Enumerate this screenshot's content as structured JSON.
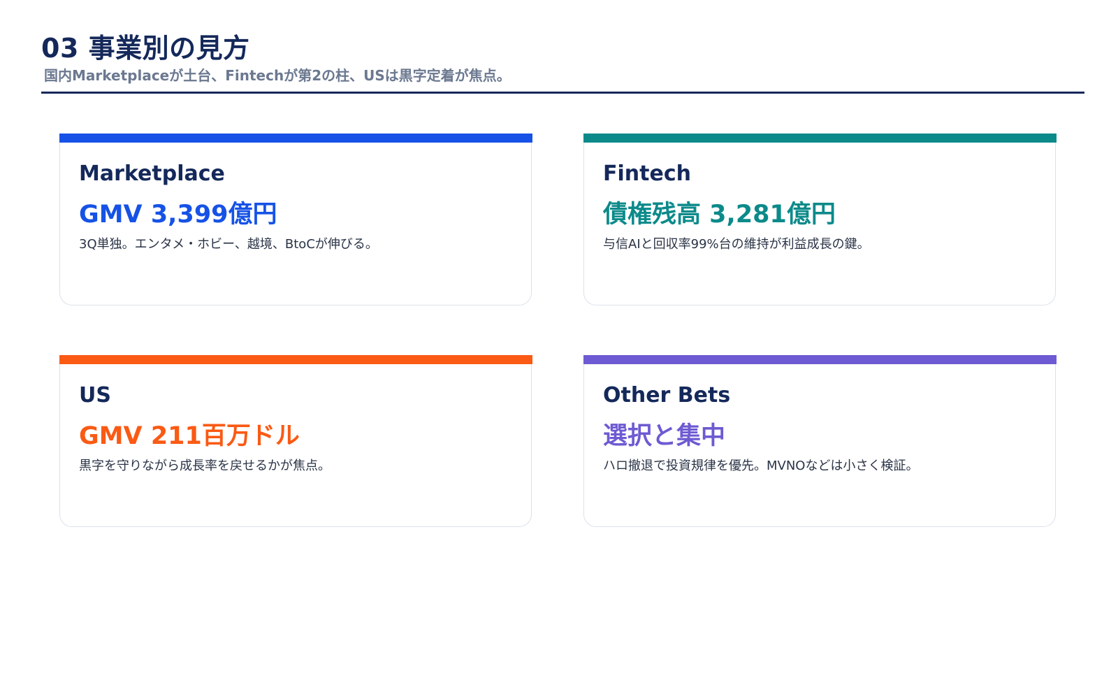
{
  "header": {
    "title": "03 事業別の見方",
    "subtitle": "国内Marketplaceが土台、Fintechが第2の柱、USは黒字定着が焦点。"
  },
  "segments": [
    {
      "name": "Marketplace",
      "metric": "GMV 3,399億円",
      "description": "3Q単独。エンタメ・ホビー、越境、BtoCが伸びる。",
      "accent_color": "#1652e6"
    },
    {
      "name": "Fintech",
      "metric": "債権残高 3,281億円",
      "description": "与信AIと回収率99%台の維持が利益成長の鍵。",
      "accent_color": "#0c8a8a"
    },
    {
      "name": "US",
      "metric": "GMV 211百万ドル",
      "description": "黒字を守りながら成長率を戻せるかが焦点。",
      "accent_color": "#fa5a14"
    },
    {
      "name": "Other Bets",
      "metric": "選択と集中",
      "description": "ハロ撤退で投資規律を優先。MVNOなどは小さく検証。",
      "accent_color": "#6e5ad2"
    }
  ],
  "theme": {
    "title_color": "#14285a",
    "subtitle_color": "#6b7890",
    "card_border_color": "#dbe1ea"
  }
}
